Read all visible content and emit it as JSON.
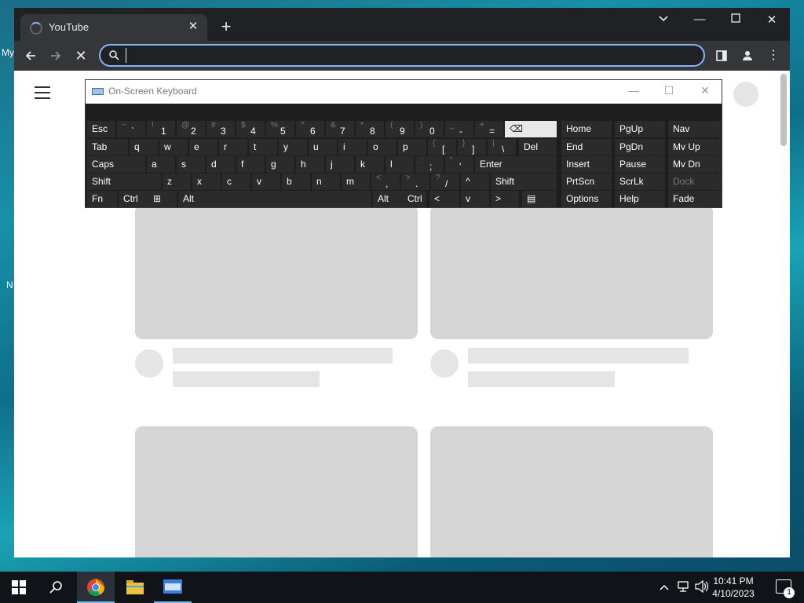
{
  "desktop": {
    "fragments": [
      "My",
      "N"
    ]
  },
  "browser": {
    "tab": {
      "title": "YouTube"
    },
    "omnibox": {
      "value": "",
      "placeholder": ""
    }
  },
  "osk": {
    "title": "On-Screen Keyboard",
    "rows": [
      [
        {
          "main": "Esc"
        },
        {
          "shift": "~",
          "lower": "`"
        },
        {
          "shift": "!",
          "lower": "1"
        },
        {
          "shift": "@",
          "lower": "2"
        },
        {
          "shift": "#",
          "lower": "3"
        },
        {
          "shift": "$",
          "lower": "4"
        },
        {
          "shift": "%",
          "lower": "5"
        },
        {
          "shift": "^",
          "lower": "6"
        },
        {
          "shift": "&",
          "lower": "7"
        },
        {
          "shift": "*",
          "lower": "8"
        },
        {
          "shift": "(",
          "lower": "9"
        },
        {
          "shift": ")",
          "lower": "0"
        },
        {
          "shift": "_",
          "lower": "-"
        },
        {
          "shift": "+",
          "lower": "="
        },
        {
          "main": "⌫"
        },
        {
          "main": "Home"
        },
        {
          "main": "PgUp"
        },
        {
          "main": "Nav"
        }
      ],
      [
        {
          "main": "Tab"
        },
        {
          "main": "q"
        },
        {
          "main": "w"
        },
        {
          "main": "e"
        },
        {
          "main": "r"
        },
        {
          "main": "t"
        },
        {
          "main": "y"
        },
        {
          "main": "u"
        },
        {
          "main": "i"
        },
        {
          "main": "o"
        },
        {
          "main": "p"
        },
        {
          "shift": "{",
          "lower": "["
        },
        {
          "shift": "}",
          "lower": "]"
        },
        {
          "shift": "|",
          "lower": "\\"
        },
        {
          "main": "Del"
        },
        {
          "main": "End"
        },
        {
          "main": "PgDn"
        },
        {
          "main": "Mv Up"
        }
      ],
      [
        {
          "main": "Caps"
        },
        {
          "main": "a"
        },
        {
          "main": "s"
        },
        {
          "main": "d"
        },
        {
          "main": "f"
        },
        {
          "main": "g"
        },
        {
          "main": "h"
        },
        {
          "main": "j"
        },
        {
          "main": "k"
        },
        {
          "main": "l"
        },
        {
          "shift": ":",
          "lower": ";"
        },
        {
          "shift": "\"",
          "lower": "'"
        },
        {
          "main": "Enter"
        },
        {
          "main": "Insert"
        },
        {
          "main": "Pause"
        },
        {
          "main": "Mv Dn"
        }
      ],
      [
        {
          "main": "Shift"
        },
        {
          "main": "z"
        },
        {
          "main": "x"
        },
        {
          "main": "c"
        },
        {
          "main": "v"
        },
        {
          "main": "b"
        },
        {
          "main": "n"
        },
        {
          "main": "m"
        },
        {
          "shift": "<",
          "lower": ","
        },
        {
          "shift": ">",
          "lower": "."
        },
        {
          "shift": "?",
          "lower": "/"
        },
        {
          "main": "^"
        },
        {
          "main": "Shift"
        },
        {
          "main": "PrtScn"
        },
        {
          "main": "ScrLk"
        },
        {
          "main": "Dock"
        }
      ],
      [
        {
          "main": "Fn"
        },
        {
          "main": "Ctrl"
        },
        {
          "main": "⊞"
        },
        {
          "main": "Alt"
        },
        {
          "main": ""
        },
        {
          "main": "Alt"
        },
        {
          "main": "Ctrl"
        },
        {
          "main": "<"
        },
        {
          "main": "v"
        },
        {
          "main": ">"
        },
        {
          "main": "▤"
        },
        {
          "main": "Options"
        },
        {
          "main": "Help"
        },
        {
          "main": "Fade"
        }
      ]
    ]
  },
  "taskbar": {
    "time": "10:41 PM",
    "date": "4/10/2023",
    "notifications": "1"
  }
}
